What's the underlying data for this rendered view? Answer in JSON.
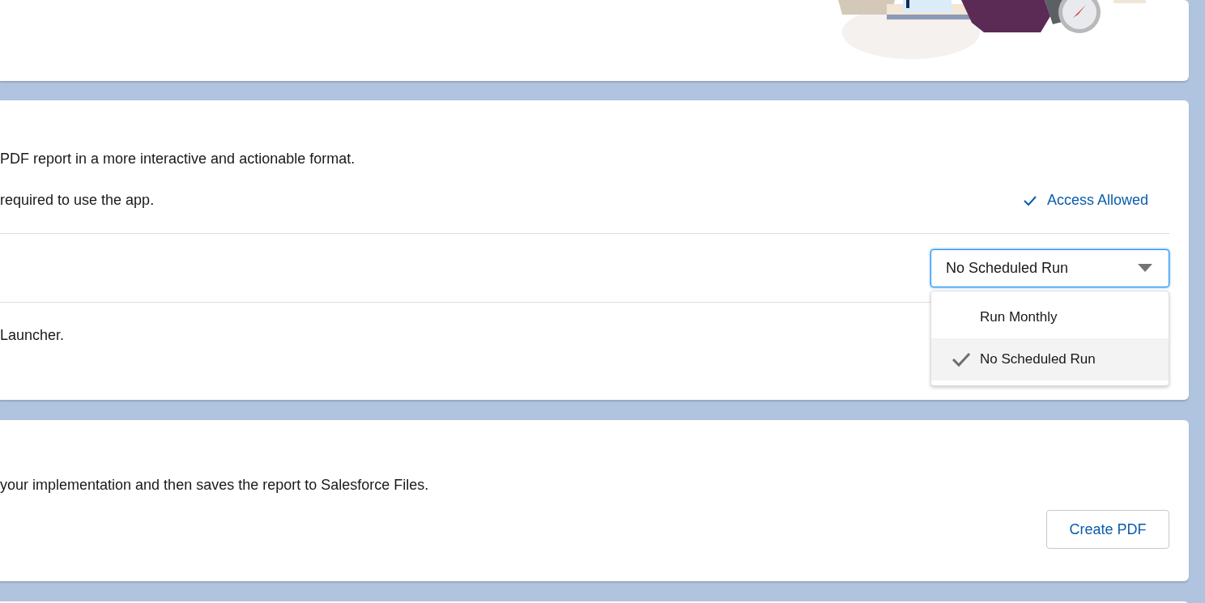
{
  "intro_card": {
    "illustration": {
      "kind": "illustration"
    }
  },
  "app_card": {
    "description": "PDF report in a more interactive and actionable format.",
    "access": {
      "text": "required to use the app.",
      "status": "Access Allowed"
    },
    "schedule": {
      "value": "No Scheduled Run",
      "expanded": true,
      "options": [
        {
          "label": "Run Monthly",
          "selected": false
        },
        {
          "label": "No Scheduled Run",
          "selected": true
        }
      ]
    },
    "launcher": {
      "text": "Launcher."
    }
  },
  "pdf_card": {
    "description": "your implementation and then saves the report to Salesforce Files.",
    "button": "Create PDF"
  }
}
